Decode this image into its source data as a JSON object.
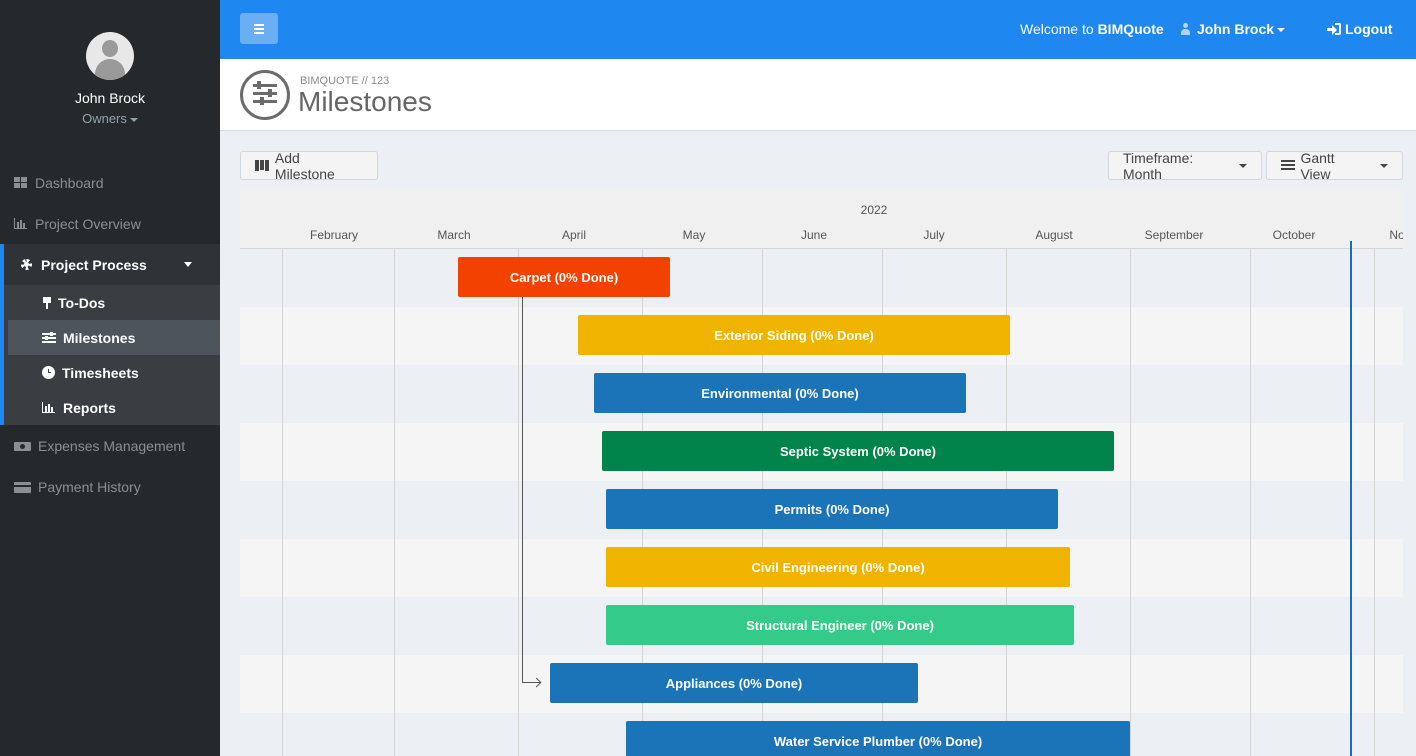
{
  "sidebar": {
    "user": {
      "name": "John Brock",
      "role": "Owners"
    },
    "items": [
      {
        "label": "Dashboard"
      },
      {
        "label": "Project Overview"
      },
      {
        "label": "Project Process"
      },
      {
        "label": "Expenses Management"
      },
      {
        "label": "Payment History"
      }
    ],
    "subitems": [
      {
        "label": "To-Dos"
      },
      {
        "label": "Milestones"
      },
      {
        "label": "Timesheets"
      },
      {
        "label": "Reports"
      }
    ]
  },
  "topbar": {
    "welcome_prefix": "Welcome to",
    "brand": "BIMQuote",
    "user": "John Brock",
    "logout": "Logout",
    "accent": "#1e87f0"
  },
  "header": {
    "breadcrumb": "BIMQUOTE // 123",
    "title": "Milestones"
  },
  "toolbar": {
    "add_label": "Add Milestone",
    "timeframe_label": "Timeframe: Month",
    "view_label": "Gantt View"
  },
  "gantt": {
    "year": "2022",
    "months": [
      "February",
      "March",
      "April",
      "May",
      "June",
      "July",
      "August",
      "September",
      "October",
      "Nov"
    ],
    "tasks": [
      {
        "label": "Carpet (0% Done)",
        "color": "#f34100"
      },
      {
        "label": "Exterior Siding (0% Done)",
        "color": "#f0b400"
      },
      {
        "label": "Environmental (0% Done)",
        "color": "#1b73b8"
      },
      {
        "label": "Septic System (0% Done)",
        "color": "#00844b"
      },
      {
        "label": "Permits (0% Done)",
        "color": "#1b73b8"
      },
      {
        "label": "Civil Engineering (0% Done)",
        "color": "#f0b400"
      },
      {
        "label": "Structural Engineer (0% Done)",
        "color": "#34cb8a"
      },
      {
        "label": "Appliances (0% Done)",
        "color": "#1b73b8"
      },
      {
        "label": "Water Service Plumber (0% Done)",
        "color": "#1b73b8"
      }
    ]
  }
}
